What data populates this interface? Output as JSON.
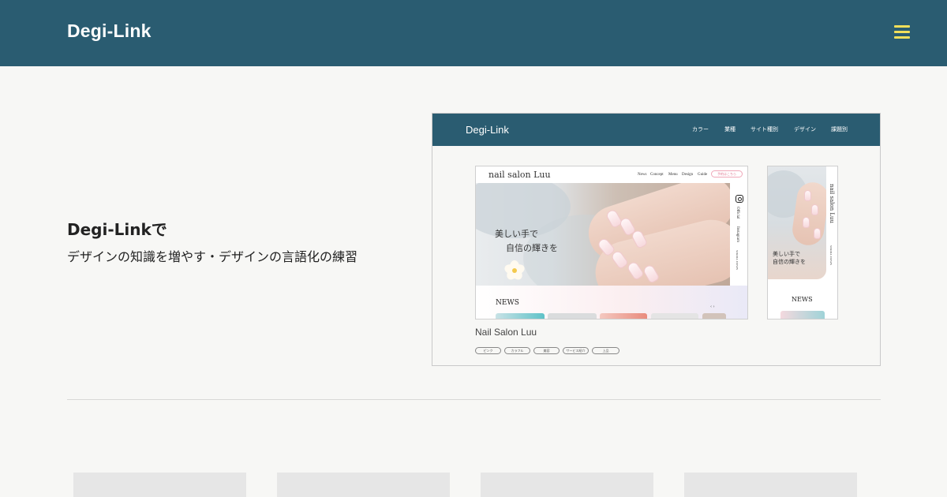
{
  "header": {
    "logo": "Degi-Link"
  },
  "hero": {
    "title": "Degi-Linkで",
    "subtitle": "デザインの知識を増やす・デザインの言語化の練習"
  },
  "preview": {
    "logo": "Degi-Link",
    "nav": [
      "カラー",
      "業種",
      "サイト種別",
      "デザイン",
      "課題別"
    ],
    "desktop": {
      "logo": "nail salon Luu",
      "menu": [
        "News",
        "Concept",
        "Menu",
        "Design",
        "Guide"
      ],
      "pill": "予約はこちら",
      "catch_line1": "美しい手で",
      "catch_line2": "自信の輝きを",
      "side_links": [
        "Official",
        "Instagram",
        "SCROLL DOWN"
      ],
      "news": "NEWS",
      "arrows": "‹    ›"
    },
    "mobile": {
      "logo": "nail salon Luu",
      "catch_line1": "美しい手で",
      "catch_line2": "自信の輝きを",
      "side_text": "SCROLL DOWN",
      "news": "NEWS"
    },
    "card_title": "Nail Salon Luu",
    "tags": [
      "ピンク",
      "カラフル",
      "美容",
      "サービス紹介",
      "上品"
    ]
  },
  "colors": {
    "brand": "#2a5c71",
    "menu_icon": "#f1df5a",
    "background": "#f7f7f5"
  },
  "icons": {
    "menu": "hamburger-icon",
    "instagram": "instagram-icon"
  }
}
